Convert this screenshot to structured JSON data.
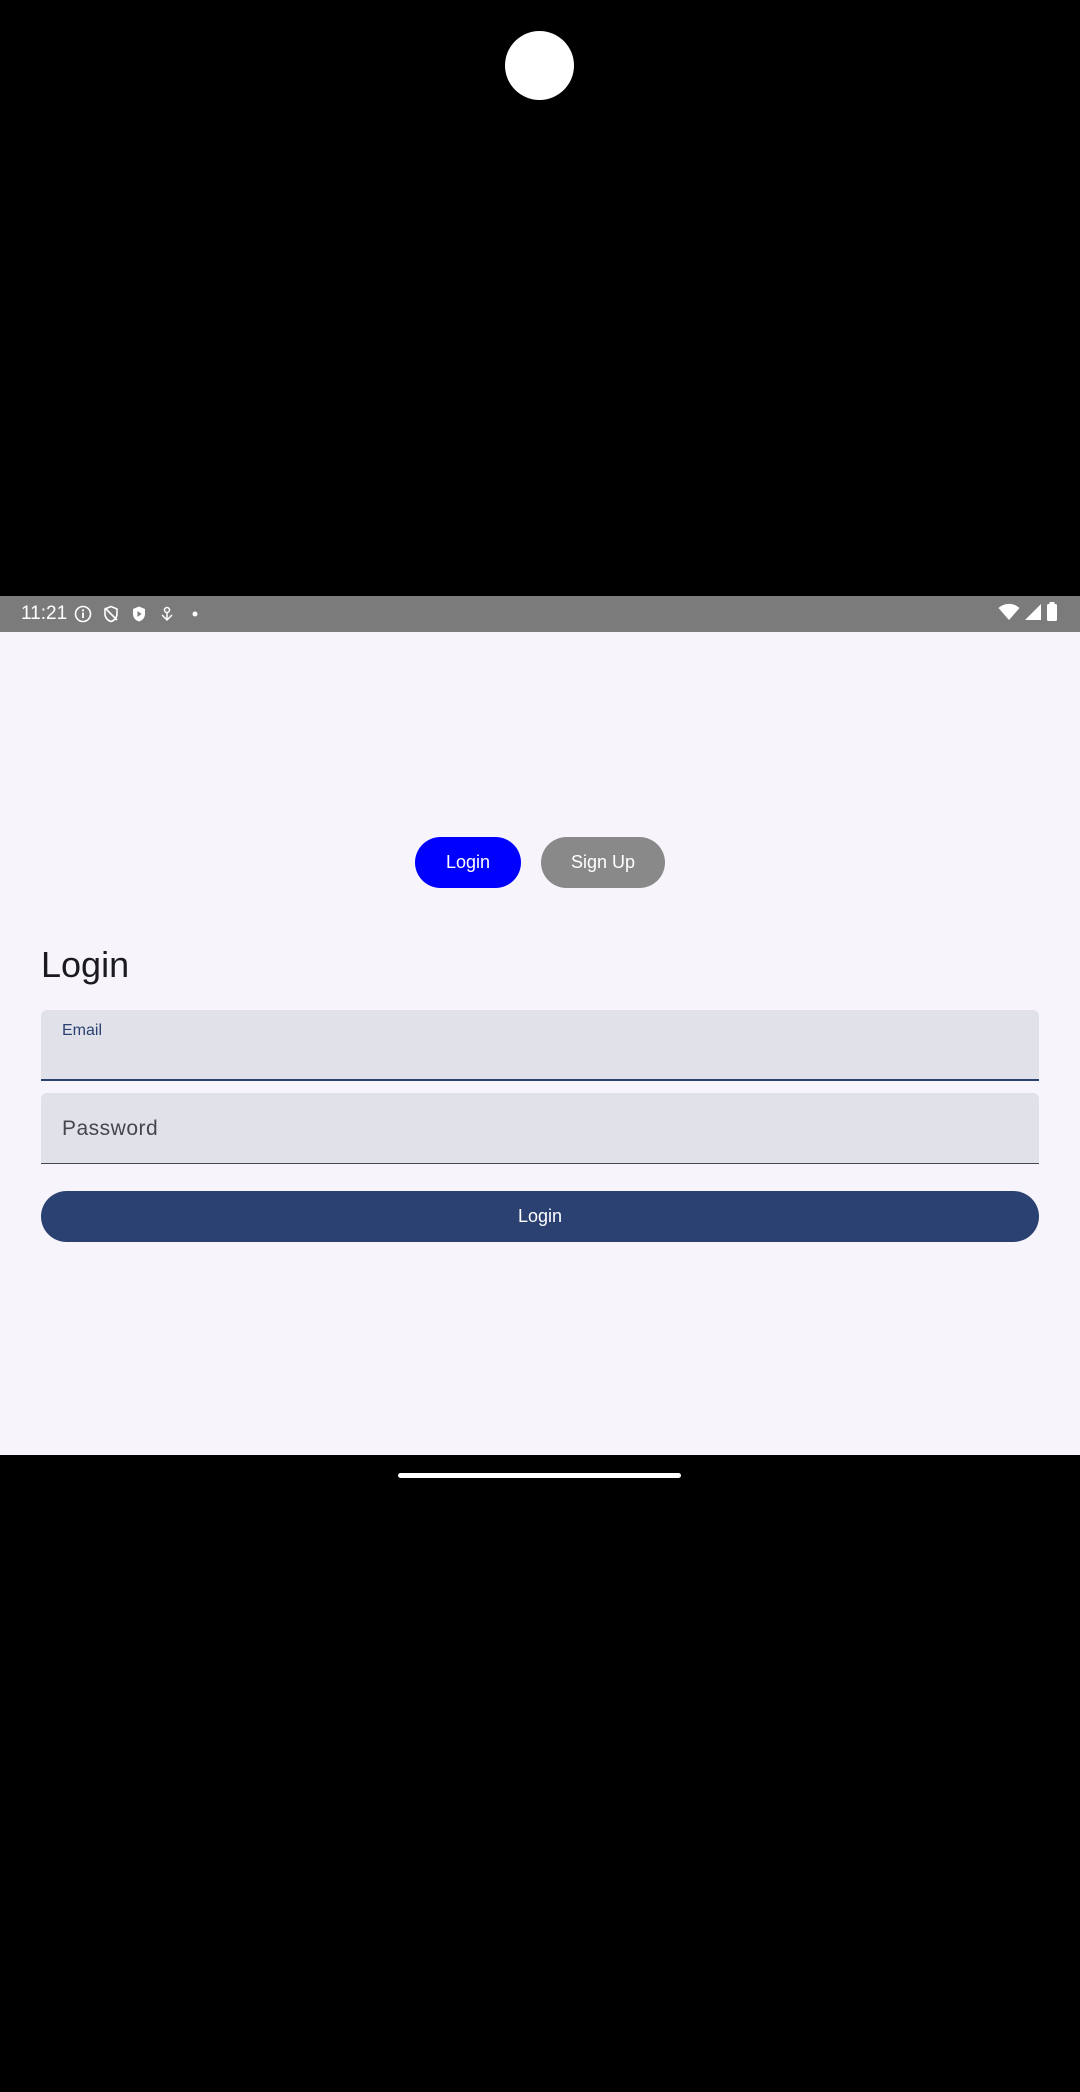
{
  "status_bar": {
    "time": "11:21",
    "left_icons": [
      "info-icon",
      "shield-off-icon",
      "shield-play-icon",
      "download-icon",
      "dot-icon"
    ],
    "right_icons": [
      "wifi-icon",
      "signal-icon",
      "battery-icon"
    ]
  },
  "tabs": {
    "login_label": "Login",
    "signup_label": "Sign Up",
    "active": "login",
    "active_color": "#0000ff",
    "inactive_color": "#898989"
  },
  "form": {
    "title": "Login",
    "email": {
      "label": "Email",
      "value": ""
    },
    "password": {
      "label": "Password",
      "value": ""
    },
    "submit_label": "Login"
  },
  "colors": {
    "primary": "#2b4172",
    "background": "#f7f5fb",
    "field_background": "#e1e1ea"
  }
}
